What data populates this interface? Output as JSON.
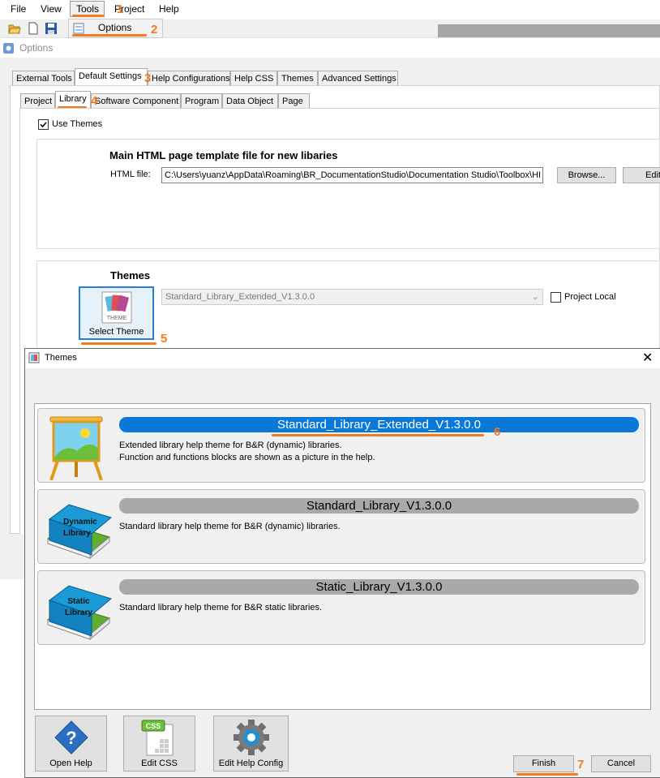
{
  "menubar": {
    "items": [
      "File",
      "View",
      "Tools",
      "Project",
      "Help"
    ],
    "tools_dropdown": {
      "options_label": "Options"
    }
  },
  "options_window": {
    "title": "Options",
    "main_tabs": [
      "External Tools",
      "Default Settings",
      "Help Configurations",
      "Help CSS",
      "Themes",
      "Advanced Settings"
    ],
    "sub_tabs": [
      "Project",
      "Library",
      "Software Component",
      "Program",
      "Data Object",
      "Page"
    ],
    "use_themes_label": "Use Themes",
    "use_themes_checked": true,
    "template_section": {
      "heading": "Main HTML page template file for new libaries",
      "html_file_label": "HTML file:",
      "html_file_value": "C:\\Users\\yuanz\\AppData\\Roaming\\BR_DocumentationStudio\\Documentation Studio\\Toolbox\\HI",
      "browse_label": "Browse...",
      "edit_label": "Edit"
    },
    "themes_section": {
      "heading": "Themes",
      "select_theme_label": "Select Theme",
      "theme_icon_text": "THEME",
      "selected_theme": "Standard_Library_Extended_V1.3.0.0",
      "project_local_label": "Project Local",
      "project_local_checked": false
    }
  },
  "themes_dialog": {
    "title": "Themes",
    "themes": [
      {
        "name": "Standard_Library_Extended_V1.3.0.0",
        "desc": [
          "Extended library help theme for B&R (dynamic) libraries.",
          "Function and functions blocks are shown as a picture in the help."
        ],
        "selected": true,
        "icon": "easel-icon"
      },
      {
        "name": "Standard_Library_V1.3.0.0",
        "desc": [
          "Standard library help theme for B&R (dynamic) libraries."
        ],
        "selected": false,
        "icon": "dynamic-library-book-icon",
        "icon_text": [
          "Dynamic",
          "Library"
        ]
      },
      {
        "name": "Static_Library_V1.3.0.0",
        "desc": [
          "Standard library help theme for B&R static libraries."
        ],
        "selected": false,
        "icon": "static-library-book-icon",
        "icon_text": [
          "Static",
          "Library"
        ]
      }
    ],
    "buttons": {
      "open_help": "Open Help",
      "edit_css": "Edit CSS",
      "css_icon_text": "CSS",
      "edit_help_config": "Edit Help Config",
      "finish": "Finish",
      "cancel": "Cancel"
    }
  },
  "annotations": [
    "1",
    "2",
    "3",
    "4",
    "5",
    "6",
    "7"
  ],
  "colors": {
    "accent_orange": "#f47a20",
    "selected_pill": "#0a78d7",
    "unselected_pill": "#a9a9a9",
    "window_border": "#2a7fc9"
  }
}
